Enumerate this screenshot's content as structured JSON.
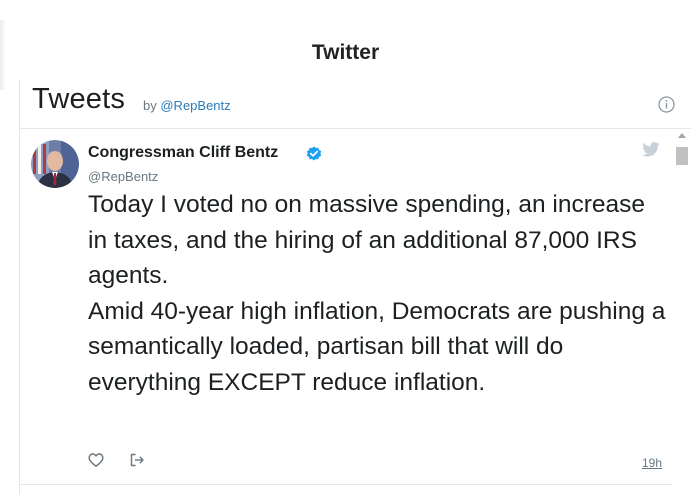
{
  "page": {
    "section_title": "Twitter"
  },
  "widget": {
    "title": "Tweets",
    "by_label": "by",
    "handle": "@RepBentz",
    "info_icon": "info-icon"
  },
  "tweet": {
    "author_name": "Congressman Cliff Bentz",
    "author_handle": "@RepBentz",
    "verified": true,
    "text_lines": [
      "Today I voted no on massive spending, an increase in taxes, and the hiring of an additional 87,000 IRS agents.",
      "Amid 40-year high inflation, Democrats are pushing a semantically loaded, partisan bill that will do everything EXCEPT reduce inflation."
    ],
    "timestamp": "19h",
    "icons": {
      "like": "heart-icon",
      "share": "share-icon",
      "brand": "twitter-bird-icon",
      "verified": "verified-badge-icon"
    }
  },
  "colors": {
    "text": "#1c2022",
    "muted": "#697882",
    "link": "#2b7bb9",
    "verified": "#1da1f2",
    "divider": "#e1e8ed"
  }
}
